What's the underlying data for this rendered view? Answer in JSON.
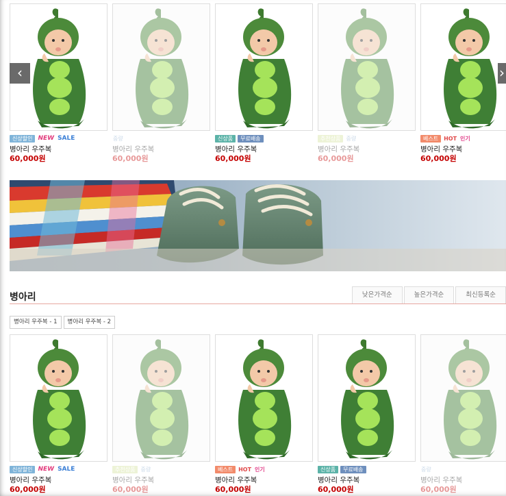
{
  "products_top": [
    {
      "name": "병아리 우주복",
      "price": "60,000원",
      "faded": false,
      "badges": [
        "rate",
        "new",
        "sale"
      ]
    },
    {
      "name": "병아리 우주복",
      "price": "60,000원",
      "faded": true,
      "badges": [
        "mid"
      ]
    },
    {
      "name": "병아리 우주복",
      "price": "60,000원",
      "faded": false,
      "badges": [
        "newarr",
        "free"
      ]
    },
    {
      "name": "병아리 우주복",
      "price": "60,000원",
      "faded": true,
      "badges": [
        "rec",
        "mid"
      ]
    },
    {
      "name": "병아리 우주복",
      "price": "60,000원",
      "faded": false,
      "badges": [
        "best",
        "hot",
        "pop"
      ]
    }
  ],
  "products_bottom": [
    {
      "name": "병아리 우주복",
      "price": "60,000원",
      "faded": false,
      "badges": [
        "rate",
        "new",
        "sale"
      ]
    },
    {
      "name": "병아리 우주복",
      "price": "60,000원",
      "faded": true,
      "badges": [
        "rec",
        "mid"
      ]
    },
    {
      "name": "병아리 우주복",
      "price": "60,000원",
      "faded": false,
      "badges": [
        "best",
        "hot",
        "pop"
      ]
    },
    {
      "name": "병아리 우주복",
      "price": "60,000원",
      "faded": false,
      "badges": [
        "newarr",
        "free"
      ]
    },
    {
      "name": "병아리 우주복",
      "price": "60,000원",
      "faded": true,
      "badges": [
        "mid"
      ]
    }
  ],
  "badge_labels": {
    "rate": "신상할인",
    "new": "NEW",
    "sale": "SALE",
    "newarr": "신상품",
    "free": "무료배송",
    "best": "베스트",
    "hot": "HOT",
    "pop": "인기",
    "rec": "추천상품",
    "mid": "중량"
  },
  "slider": {
    "prev_icon": "‹",
    "next_icon": "›"
  },
  "section": {
    "title": "병아리",
    "sort_tabs": [
      "낮은가격순",
      "높은가격순",
      "최신등록순"
    ],
    "subcategories": [
      "병아리 우주복 - 1",
      "병아리 우주복 - 2"
    ]
  },
  "colors": {
    "price": "#c40000",
    "accent_line": "#e7a7a0"
  }
}
